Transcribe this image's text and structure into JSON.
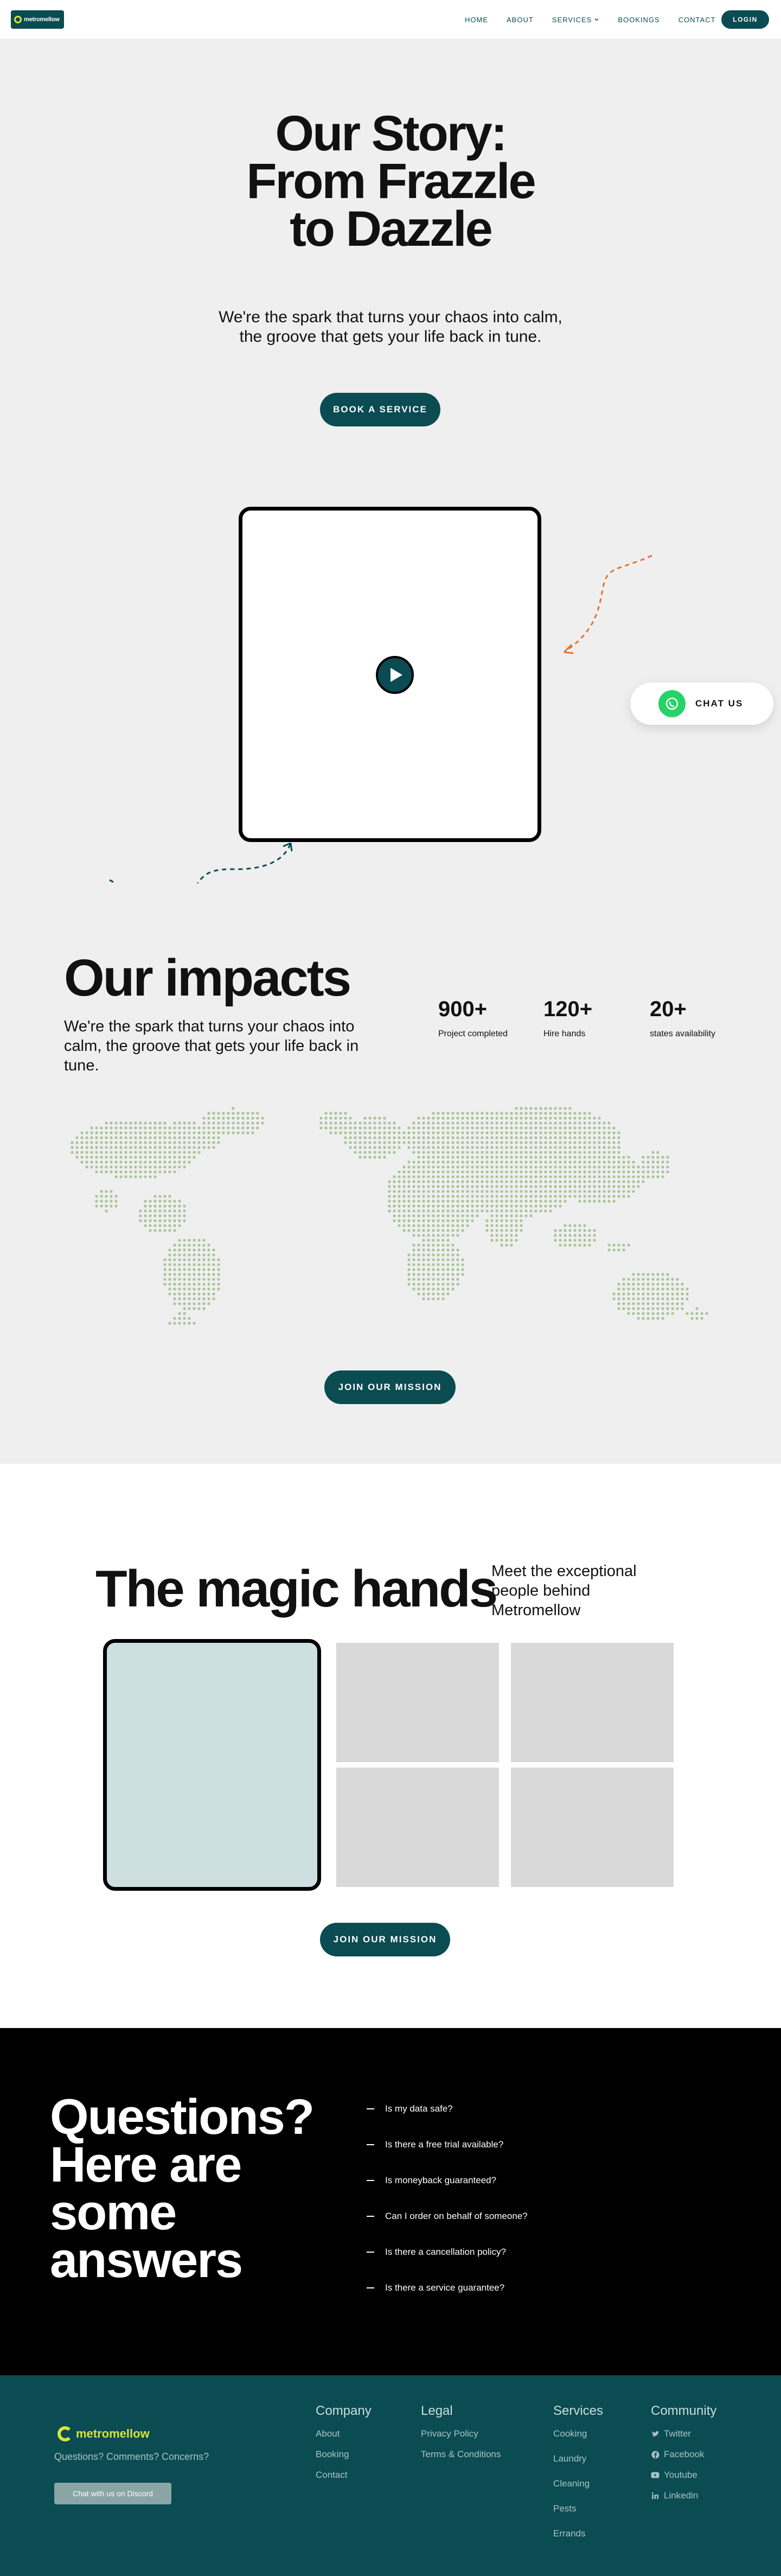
{
  "brand": {
    "name": "metromellow",
    "colors": {
      "primary": "#0b4b52",
      "accent": "#d8e33a",
      "whatsapp": "#25d366",
      "curve_orange": "#e8722a"
    }
  },
  "nav": {
    "links": [
      "HOME",
      "ABOUT",
      "SERVICES",
      "BOOKINGS",
      "CONTACT"
    ],
    "services_dropdown_icon": "chevron-down-icon",
    "login_label": "LOGIN"
  },
  "hero": {
    "title_lines": [
      "Our Story:",
      "From Frazzle",
      "to Dazzle"
    ],
    "subtitle": "We're the spark that turns your chaos into calm, the groove that gets your life back in tune.",
    "cta_label": "BOOK A SERVICE"
  },
  "chat": {
    "label": "CHAT US",
    "icon": "whatsapp-icon"
  },
  "impact": {
    "title": "Our impacts",
    "subtitle": "We're the spark that turns your chaos into calm, the groove that gets your life back in tune.",
    "stats": [
      {
        "value": "900+",
        "label": "Project completed"
      },
      {
        "value": "120+",
        "label": "Hire hands"
      },
      {
        "value": "20+",
        "label": "states availability"
      }
    ],
    "cta_label": "JOIN OUR MISSION"
  },
  "magic": {
    "title": "The magic hands",
    "subtitle": "Meet the exceptional people behind Metromellow",
    "cta_label": "JOIN OUR MISSION"
  },
  "faq": {
    "title_lines": [
      "Questions?",
      "Here are",
      "some",
      "answers"
    ],
    "items": [
      "Is my data safe?",
      "Is there a free trial available?",
      "Is moneyback guaranteed?",
      "Can I order on behalf of someone?",
      "Is there a cancellation policy?",
      "Is there a service guarantee?"
    ]
  },
  "footer": {
    "tagline": "Questions? Comments? Concerns?",
    "discord_label": "Chat with us on Discord",
    "columns": {
      "company": {
        "title": "Company",
        "links": [
          "About",
          "Booking",
          "Contact"
        ]
      },
      "legal": {
        "title": "Legal",
        "links": [
          "Privacy Policy",
          "Terms & Conditions"
        ]
      },
      "services": {
        "title": "Services",
        "links": [
          "Cooking",
          "Laundry",
          "Cleaning",
          "Pests",
          "Errands"
        ]
      },
      "community": {
        "title": "Community",
        "links": [
          "Twitter",
          "Facebook",
          "Youtube",
          "Linkedin"
        ],
        "icons": [
          "twitter-icon",
          "facebook-icon",
          "youtube-icon",
          "linkedin-icon"
        ]
      }
    }
  }
}
